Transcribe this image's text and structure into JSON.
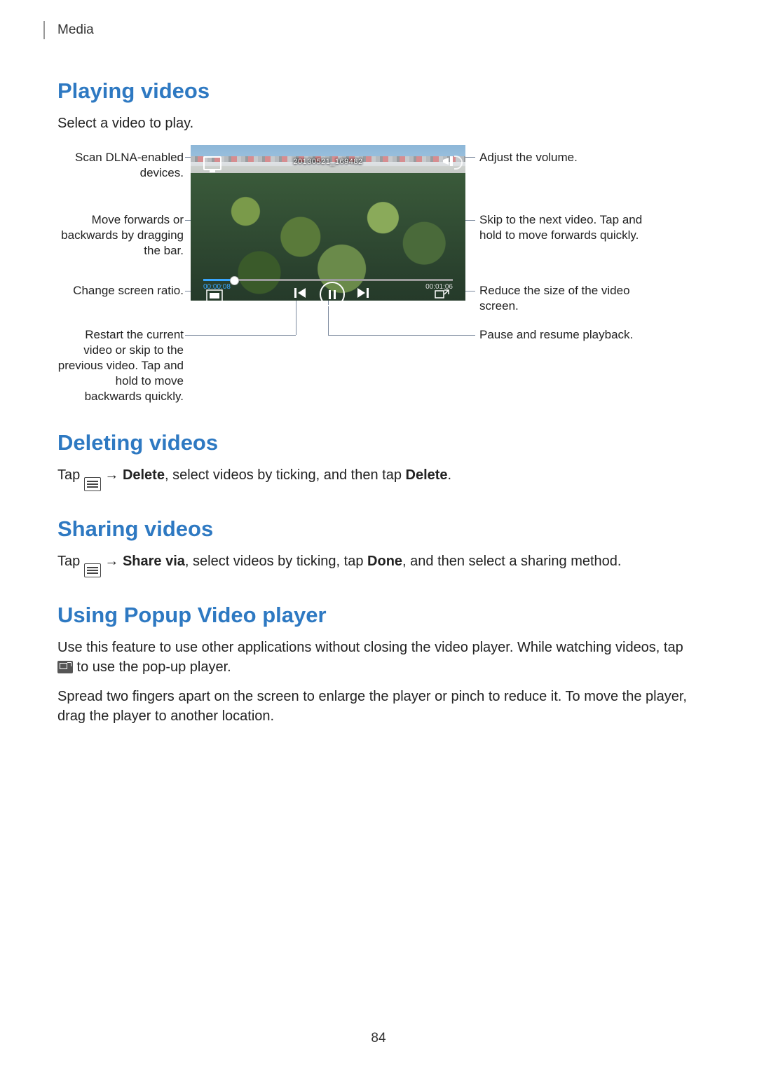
{
  "header": {
    "section": "Media"
  },
  "playing": {
    "heading": "Playing videos",
    "intro": "Select a video to play."
  },
  "player": {
    "overlay_title": "20130521_169482",
    "time_elapsed": "00:00:08",
    "time_total": "00:01:06"
  },
  "callouts": {
    "dlna": "Scan DLNA-enabled devices.",
    "seek": "Move forwards or backwards by dragging the bar.",
    "ratio": "Change screen ratio.",
    "prev": "Restart the current video or skip to the previous video. Tap and hold to move backwards quickly.",
    "volume": "Adjust the volume.",
    "next": "Skip to the next video. Tap and hold to move forwards quickly.",
    "popup": "Reduce the size of the video screen.",
    "pause": "Pause and resume playback."
  },
  "deleting": {
    "heading": "Deleting videos",
    "pre": "Tap ",
    "arrow": " → ",
    "boldA": "Delete",
    "mid": ", select videos by ticking, and then tap ",
    "boldB": "Delete",
    "end": "."
  },
  "sharing": {
    "heading": "Sharing videos",
    "pre": "Tap ",
    "arrow": " → ",
    "boldA": "Share via",
    "mid": ", select videos by ticking, tap ",
    "boldB": "Done",
    "end": ", and then select a sharing method."
  },
  "popup": {
    "heading": "Using Popup Video player",
    "p1a": "Use this feature to use other applications without closing the video player. While watching videos, tap ",
    "p1b": " to use the pop-up player.",
    "p2": "Spread two fingers apart on the screen to enlarge the player or pinch to reduce it. To move the player, drag the player to another location."
  },
  "page_number": "84"
}
